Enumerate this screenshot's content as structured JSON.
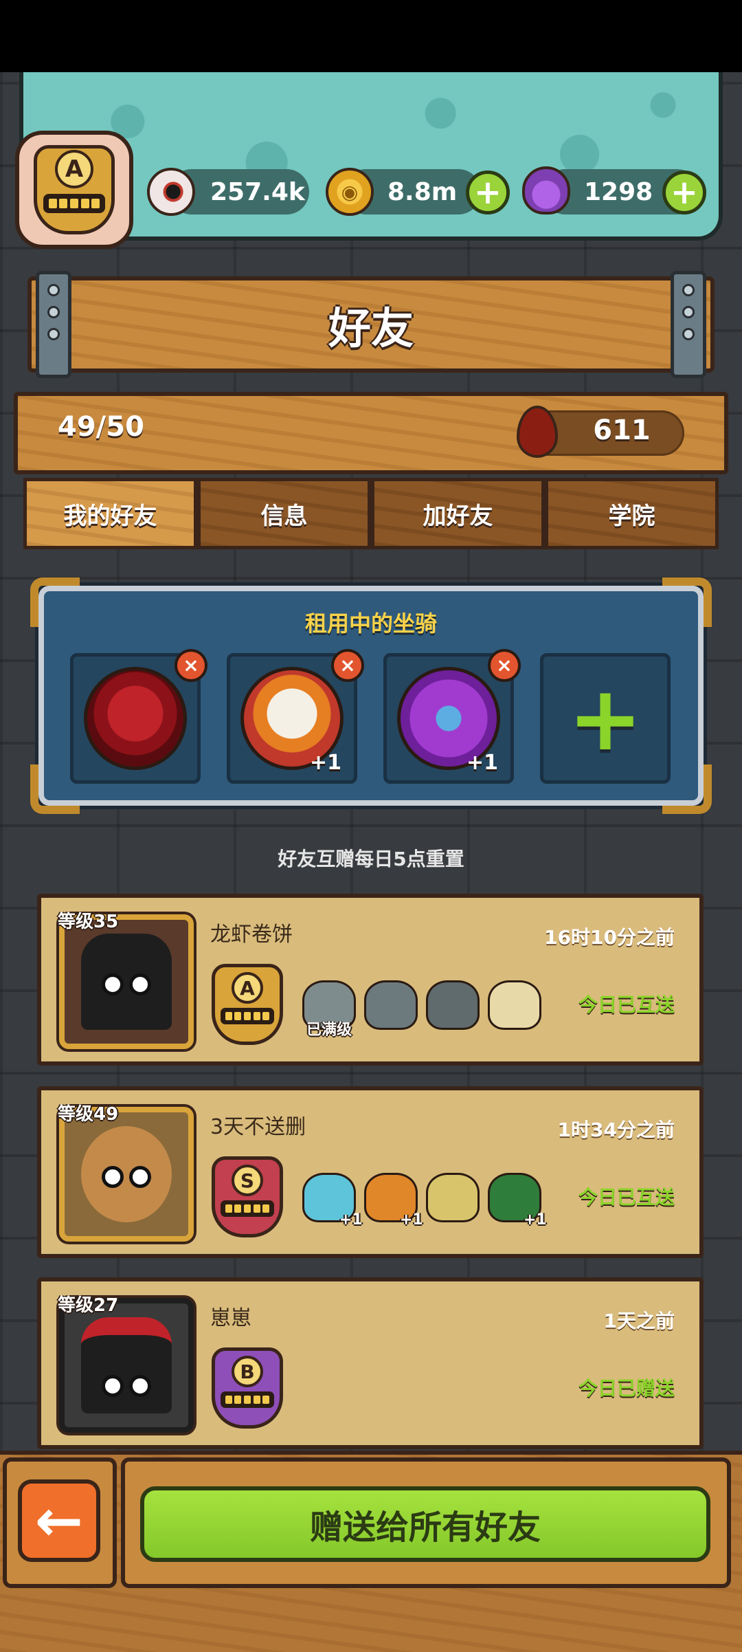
{
  "header": {
    "player_rank": "A",
    "eyes": "257.4k",
    "coins": "8.8m",
    "potions": "1298"
  },
  "title": "好友",
  "friends": {
    "count": "49/50",
    "blood": "611"
  },
  "tabs": [
    "我的好友",
    "信息",
    "加好友",
    "学院"
  ],
  "rental": {
    "title": "租用中的坐骑",
    "slots": [
      {
        "mount": "rose-mount",
        "count": ""
      },
      {
        "mount": "lion-dance-mount",
        "count": "+1"
      },
      {
        "mount": "purple-horned-monster-mount",
        "count": "+1"
      }
    ]
  },
  "reset_note": "好友互赠每日5点重置",
  "friend_list": [
    {
      "level": "等级35",
      "name": "龙虾卷饼",
      "time": "16时10分之前",
      "rank": "A",
      "mount_label": "已满级",
      "status": "今日已互送"
    },
    {
      "level": "等级49",
      "name": "3天不送删",
      "time": "1时34分之前",
      "rank": "S",
      "mount_counts": [
        "+1",
        "+1",
        "+1"
      ],
      "status": "今日已互送"
    },
    {
      "level": "等级27",
      "name": "崽崽",
      "time": "1天之前",
      "rank": "B",
      "status": "今日已赠送"
    }
  ],
  "footer": {
    "back_icon": "←",
    "gift_all": "赠送给所有好友"
  },
  "icons": {
    "plus": "+",
    "close": "×",
    "coin": "◉"
  },
  "colors": {
    "accent_green": "#8bd42a",
    "wood": "#c88a3e",
    "panel_blue": "#2f5a7c",
    "title_yellow": "#f7d24a"
  }
}
